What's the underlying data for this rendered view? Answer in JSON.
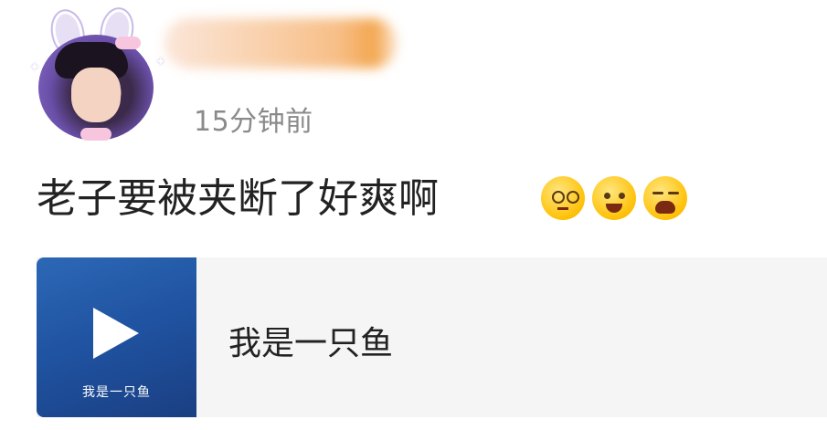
{
  "post": {
    "timestamp": "15分钟前",
    "text": "老子要被夹断了好爽啊",
    "emojis": [
      "dizzy-face-icon",
      "blushing-face-icon",
      "crying-face-icon"
    ]
  },
  "share_card": {
    "title": "我是一只鱼",
    "cover_caption": "我是一只鱼",
    "icon": "play-icon"
  },
  "colors": {
    "timestamp": "#8a8a8a",
    "text": "#222222",
    "card_bg": "#f5f5f5",
    "cover_blue": "#2c68b6"
  }
}
